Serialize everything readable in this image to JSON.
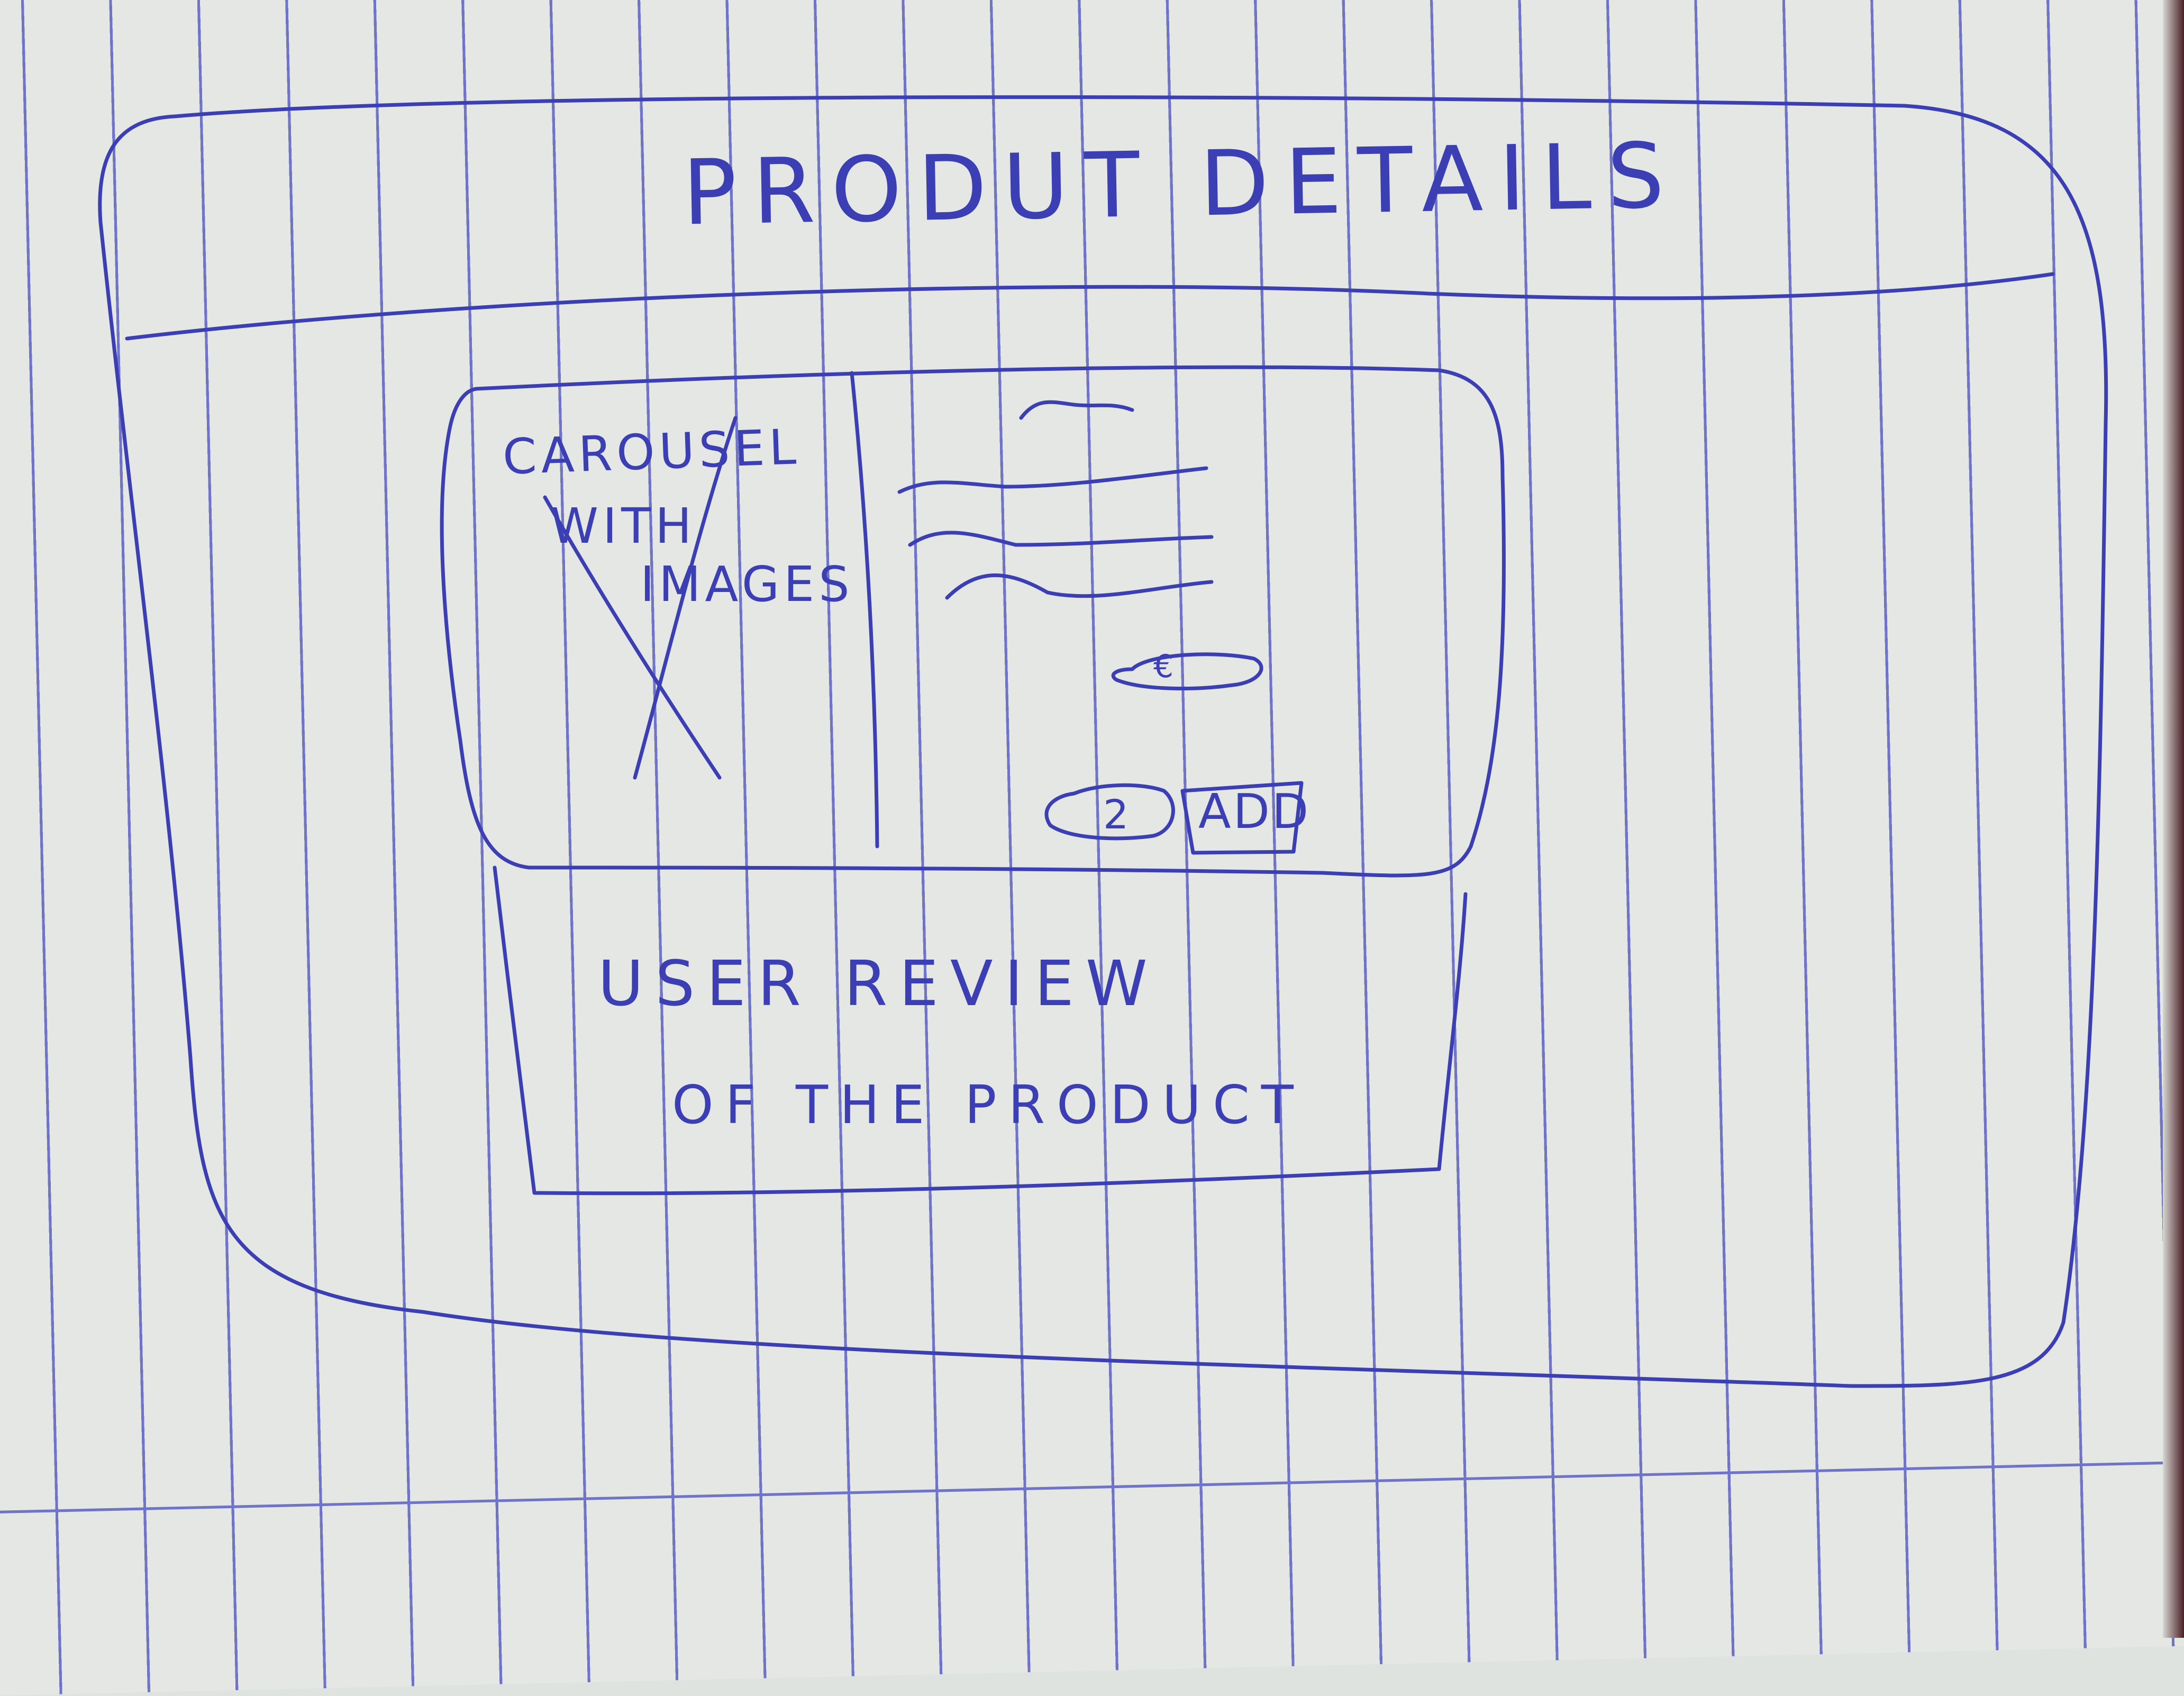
{
  "sketch": {
    "title": "PRODUT DETAILS",
    "carousel": {
      "line1": "CAROUSEL",
      "line2": "WITH",
      "line3": "IMAGES"
    },
    "price_symbol": "€",
    "quantity": "2",
    "add_label": "ADD",
    "review": {
      "line1": "USER REVIEW",
      "line2": "OF THE PRODUCT"
    }
  },
  "colors": {
    "ink": "#3b3fb3",
    "paper": "#e4e7e3",
    "ruling": "#6f74c9"
  }
}
